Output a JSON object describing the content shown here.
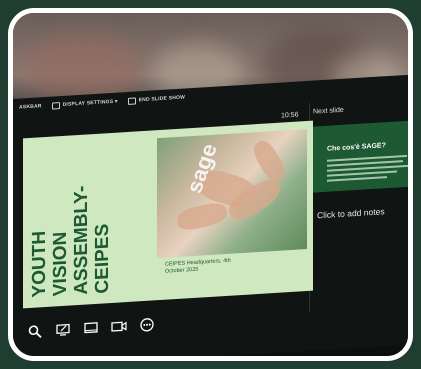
{
  "toolbar": {
    "taskbar_label": "ASKBAR",
    "display_settings_label": "DISPLAY SETTINGS ▾",
    "end_show_label": "END SLIDE SHOW"
  },
  "timer": "10:56",
  "next_slide": {
    "label": "Next slide",
    "title": "Che cos'è SAGE?"
  },
  "slide": {
    "title_lines": [
      "YOUTH",
      "VISION",
      "ASSEMBLY-",
      "CEIPES"
    ],
    "logo_text": "sage",
    "caption_line1": "CEIPES Headquarters, 4th",
    "caption_line2": "October 2025"
  },
  "notes_placeholder": "Click to add notes",
  "icons": [
    "search-icon",
    "pen-icon",
    "monitor-icon",
    "camera-icon",
    "more-icon"
  ]
}
